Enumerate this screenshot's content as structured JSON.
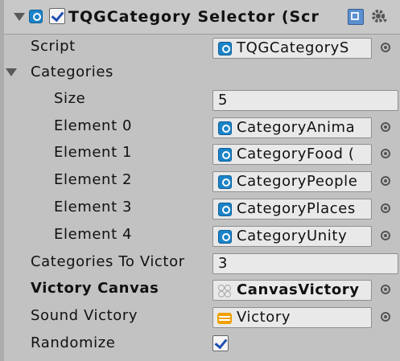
{
  "component": {
    "title": "TQGCategory Selector (Scr",
    "enabled": true
  },
  "fields": {
    "script": {
      "label": "Script",
      "value": "TQGCategoryS"
    },
    "categories": {
      "label": "Categories",
      "size_label": "Size",
      "size_value": "5",
      "elements": [
        {
          "label": "Element 0",
          "value": "CategoryAnima"
        },
        {
          "label": "Element 1",
          "value": "CategoryFood ("
        },
        {
          "label": "Element 2",
          "value": "CategoryPeople"
        },
        {
          "label": "Element 3",
          "value": "CategoryPlaces"
        },
        {
          "label": "Element 4",
          "value": "CategoryUnity"
        }
      ]
    },
    "categories_to_victory": {
      "label": "Categories To Victor",
      "value": "3"
    },
    "victory_canvas": {
      "label": "Victory Canvas",
      "value": "CanvasVictory"
    },
    "sound_victory": {
      "label": "Sound Victory",
      "value": "Victory"
    },
    "randomize": {
      "label": "Randomize",
      "checked": true
    }
  },
  "colors": {
    "panel_bg": "#c2c2c2",
    "script_icon": "#1b83c8",
    "audio_icon": "#f0a000",
    "checkmark": "#1f4fb0"
  },
  "icons": {
    "header": [
      "foldout-arrow-icon",
      "script-icon",
      "checkbox",
      "reference-icon",
      "gear-icon"
    ],
    "object_field": "object-picker-icon"
  }
}
